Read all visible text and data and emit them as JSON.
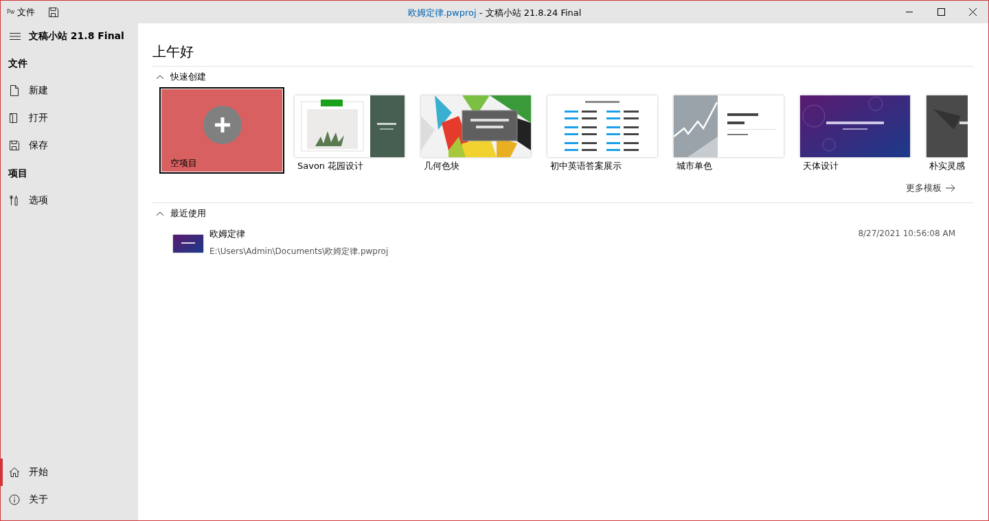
{
  "title_bar": {
    "logo": "Pw",
    "menu": "文件",
    "file_name": "欧姆定律.pwproj",
    "title_rest": " - 文稿小站 21.8.24 Final"
  },
  "sidebar": {
    "app_title": "文稿小站 21.8 Final",
    "sections": [
      {
        "heading": "文件",
        "items": [
          {
            "label": "新建",
            "selected": false
          },
          {
            "label": "打开",
            "selected": false
          },
          {
            "label": "保存",
            "selected": false
          }
        ]
      },
      {
        "heading": "项目",
        "items": [
          {
            "label": "选项",
            "selected": false
          }
        ]
      }
    ],
    "bottom_items": [
      {
        "label": "开始",
        "selected": true
      },
      {
        "label": "关于",
        "selected": false
      }
    ]
  },
  "main": {
    "greeting": "上午好",
    "quick_create": {
      "heading": "快速创建",
      "expanded": true,
      "templates": [
        {
          "kind": "blank",
          "name": "空项目",
          "selected": true
        },
        {
          "kind": "template",
          "name": "Savon 花园设计",
          "selected": false
        },
        {
          "kind": "template",
          "name": "几何色块",
          "selected": false
        },
        {
          "kind": "template",
          "name": "初中英语答案展示",
          "selected": false
        },
        {
          "kind": "template",
          "name": "城市单色",
          "selected": false
        },
        {
          "kind": "template",
          "name": "天体设计",
          "selected": false
        },
        {
          "kind": "template",
          "name": "朴实灵感",
          "selected": false
        }
      ],
      "more_link": "更多模板"
    },
    "recent": {
      "heading": "最近使用",
      "expanded": true,
      "files": [
        {
          "name": "欧姆定律",
          "path": "E:\\Users\\Admin\\Documents\\欧姆定律.pwproj",
          "date": "8/27/2021 10:56:08 AM"
        }
      ]
    }
  }
}
